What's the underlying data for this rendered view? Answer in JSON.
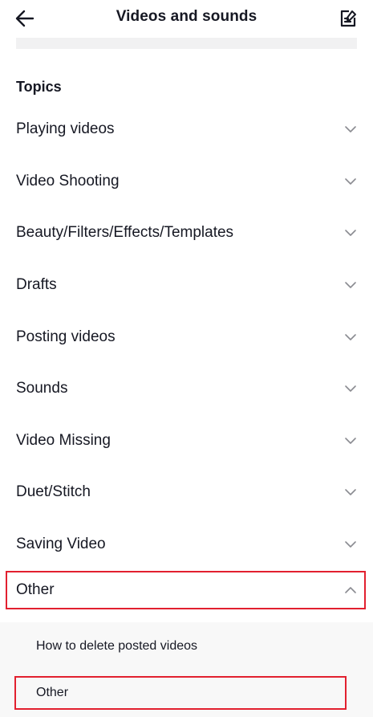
{
  "header": {
    "title": "Videos and sounds",
    "back_icon": "arrow-left-icon",
    "edit_icon": "edit-note-icon"
  },
  "section": {
    "title": "Topics"
  },
  "topics": [
    {
      "label": "Playing videos",
      "expanded": false
    },
    {
      "label": "Video Shooting",
      "expanded": false
    },
    {
      "label": "Beauty/Filters/Effects/Templates",
      "expanded": false
    },
    {
      "label": "Drafts",
      "expanded": false
    },
    {
      "label": "Posting videos",
      "expanded": false
    },
    {
      "label": "Sounds",
      "expanded": false
    },
    {
      "label": "Video Missing",
      "expanded": false
    },
    {
      "label": "Duet/Stitch",
      "expanded": false
    },
    {
      "label": "Saving Video",
      "expanded": false
    },
    {
      "label": "Other",
      "expanded": true
    }
  ],
  "other_subtopics": [
    {
      "label": "How to delete posted videos"
    },
    {
      "label": "Other"
    }
  ],
  "colors": {
    "highlight": "#e2202f",
    "text": "#161823",
    "chevron": "#8a8b91",
    "panel": "#f8f8f8"
  }
}
